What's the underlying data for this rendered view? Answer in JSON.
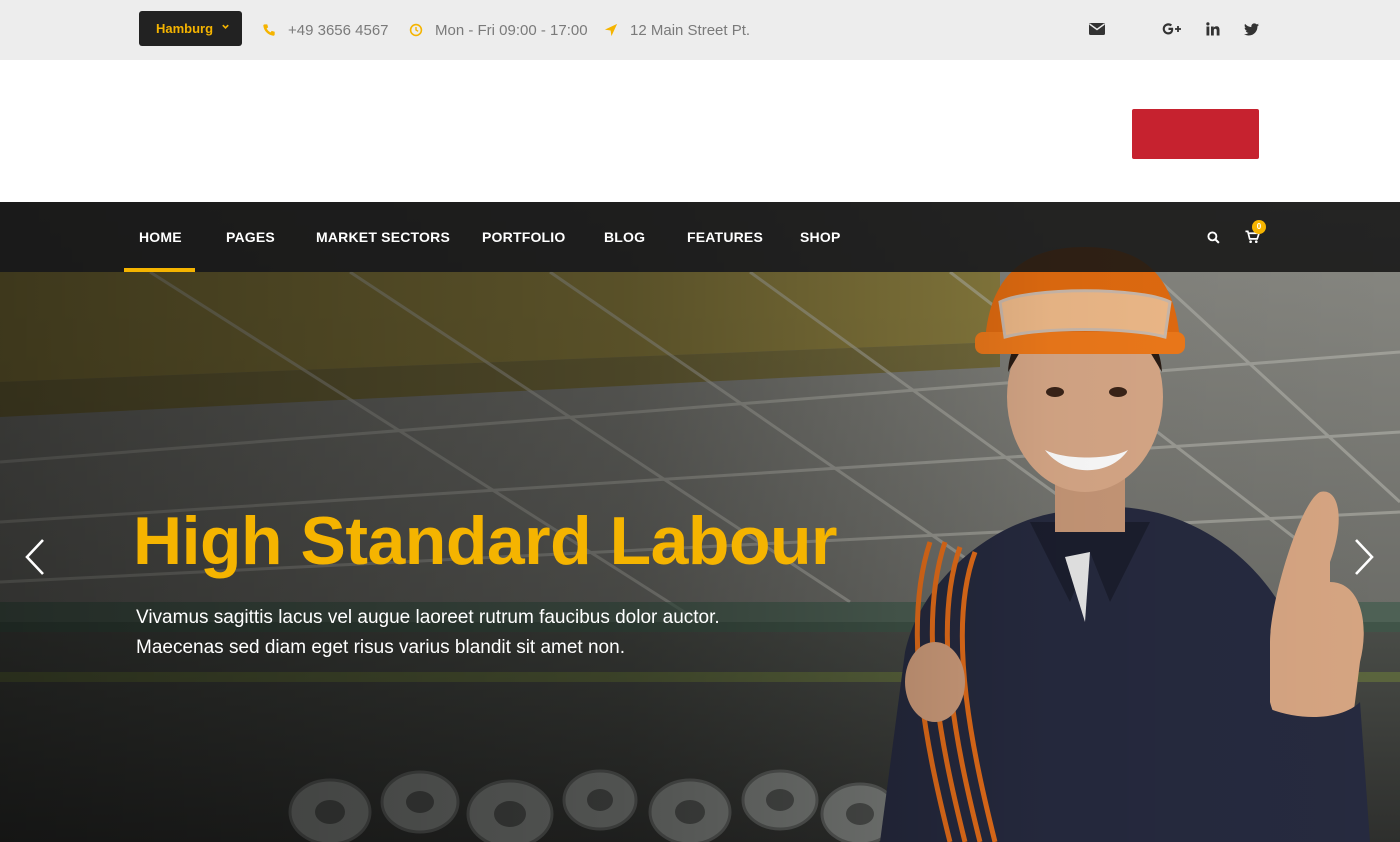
{
  "topbar": {
    "city": "Hamburg",
    "phone": "+49 3656 4567",
    "hours": "Mon - Fri 09:00 - 17:00",
    "address": "12 Main Street Pt.",
    "social_icons": [
      "envelope-icon",
      "google-plus-icon",
      "linkedin-icon",
      "twitter-icon"
    ]
  },
  "header": {
    "quote_button_label": ""
  },
  "nav": {
    "items": [
      "HOME",
      "PAGES",
      "MARKET SECTORS",
      "PORTFOLIO",
      "BLOG",
      "FEATURES",
      "SHOP"
    ],
    "active": "HOME",
    "cart_count": "0"
  },
  "hero": {
    "title": "High Standard Labour",
    "subtitle_line1": "Vivamus sagittis lacus vel augue laoreet rutrum faucibus dolor auctor.",
    "subtitle_line2": "Maecenas sed diam eget risus varius blandit sit amet non."
  },
  "colors": {
    "accent": "#f5b400",
    "brand_red": "#c6222f",
    "topbar_bg": "#ededed",
    "navbar_bg": "#161616"
  }
}
